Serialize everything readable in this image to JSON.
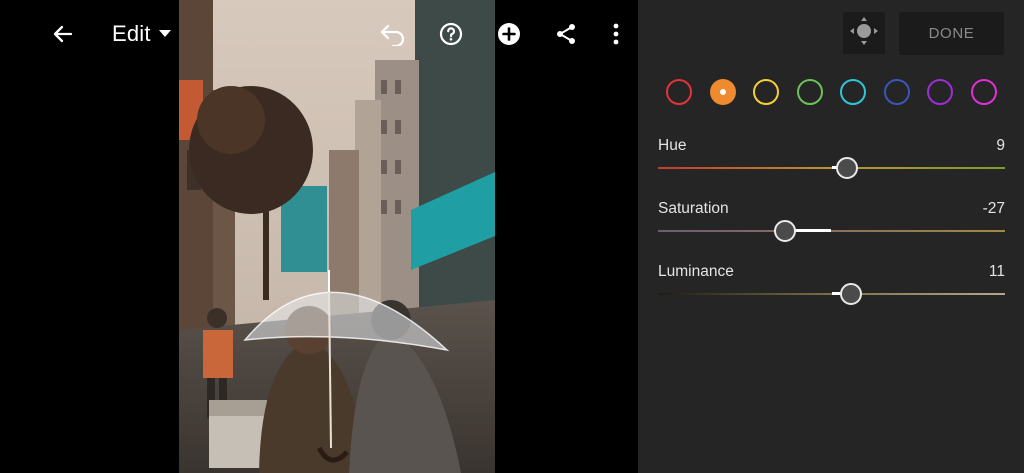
{
  "toolbar": {
    "edit_label": "Edit",
    "icons": [
      "back-arrow-icon",
      "dropdown-caret-icon",
      "undo-icon",
      "help-icon",
      "add-icon",
      "share-icon",
      "more-vertical-icon"
    ]
  },
  "panel": {
    "done_label": "DONE",
    "target_icon": "targeted-adjustment-icon",
    "colors": [
      {
        "name": "red",
        "hex": "#e2333a",
        "selected": false
      },
      {
        "name": "orange",
        "hex": "#ef8a2e",
        "selected": true
      },
      {
        "name": "yellow",
        "hex": "#f2d034",
        "selected": false
      },
      {
        "name": "green",
        "hex": "#6bc05a",
        "selected": false
      },
      {
        "name": "aqua",
        "hex": "#2fc6d8",
        "selected": false
      },
      {
        "name": "blue",
        "hex": "#3c55b8",
        "selected": false
      },
      {
        "name": "purple",
        "hex": "#9b2fd2",
        "selected": false
      },
      {
        "name": "magenta",
        "hex": "#e02fd8",
        "selected": false
      }
    ],
    "sliders": [
      {
        "label": "Hue",
        "value": "9",
        "amount": 9,
        "track_colors": [
          "#c33a30",
          "#b99536",
          "#7e9c2c"
        ]
      },
      {
        "label": "Saturation",
        "value": "-27",
        "amount": -27,
        "track_colors": [
          "#6d5a74",
          "#8a7060",
          "#a08a3c"
        ]
      },
      {
        "label": "Luminance",
        "value": "11",
        "amount": 11,
        "track_colors": [
          "#1e1d16",
          "#7b7144",
          "#b3a88a"
        ]
      }
    ]
  }
}
